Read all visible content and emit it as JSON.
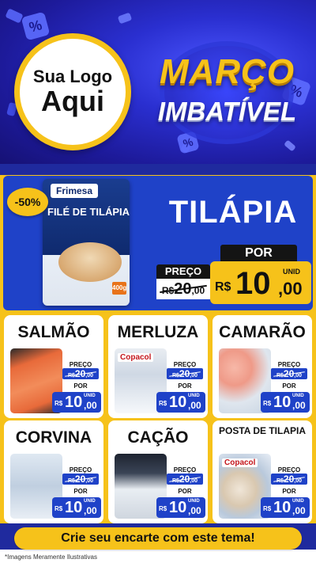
{
  "header": {
    "logo_line1": "Sua Logo",
    "logo_line2": "Aqui",
    "title_line1": "MARÇO",
    "title_line2": "IMBATÍVEL",
    "deco_symbol": "%"
  },
  "hero": {
    "discount_badge": "-50%",
    "product_name": "TILÁPIA",
    "package_brand": "Frimesa",
    "package_text": "FILÉ DE TILÁPIA",
    "package_weight": "400g",
    "old_label": "PREÇO",
    "old_price_int": "20",
    "old_price_dec": ",00",
    "old_currency": "R$",
    "new_label": "POR",
    "currency": "R$",
    "price_int": "10",
    "price_dec": ",00",
    "unit": "UNID"
  },
  "cards": [
    {
      "name": "SALMÃO",
      "old_label": "PREÇO",
      "old_currency": "R$",
      "old_int": "20",
      "old_dec": ",00",
      "new_label": "POR",
      "currency": "R$",
      "int": "10",
      "dec": ",00",
      "unit": "UNID"
    },
    {
      "name": "MERLUZA",
      "brand": "Copacol",
      "old_label": "PREÇO",
      "old_currency": "R$",
      "old_int": "20",
      "old_dec": ",00",
      "new_label": "POR",
      "currency": "R$",
      "int": "10",
      "dec": ",00",
      "unit": "UNID"
    },
    {
      "name": "CAMARÃO",
      "old_label": "PREÇO",
      "old_currency": "R$",
      "old_int": "20",
      "old_dec": ",00",
      "new_label": "POR",
      "currency": "R$",
      "int": "10",
      "dec": ",00",
      "unit": "UNID"
    },
    {
      "name": "CORVINA",
      "old_label": "PREÇO",
      "old_currency": "R$",
      "old_int": "20",
      "old_dec": ",00",
      "new_label": "POR",
      "currency": "R$",
      "int": "10",
      "dec": ",00",
      "unit": "UNID"
    },
    {
      "name": "CAÇÃO",
      "old_label": "PREÇO",
      "old_currency": "R$",
      "old_int": "20",
      "old_dec": ",00",
      "new_label": "POR",
      "currency": "R$",
      "int": "10",
      "dec": ",00",
      "unit": "UNID"
    },
    {
      "name": "POSTA DE TILAPIA",
      "brand": "Copacol",
      "old_label": "PREÇO",
      "old_currency": "R$",
      "old_int": "20",
      "old_dec": ",00",
      "new_label": "POR",
      "currency": "R$",
      "int": "10",
      "dec": ",00",
      "unit": "UNID"
    }
  ],
  "cta": "Crie seu encarte com este tema!",
  "disclaimer": "*Imagens Meramente Ilustrativas",
  "colors": {
    "yellow": "#f6c21a",
    "blue": "#1f42c8",
    "navy": "#1f2a9e"
  }
}
